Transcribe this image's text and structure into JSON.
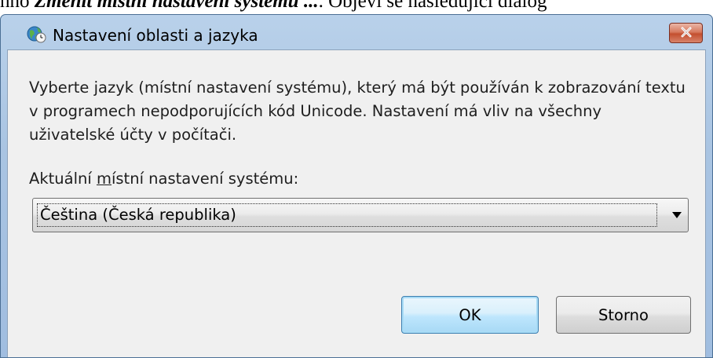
{
  "document": {
    "prefix": "hno ",
    "emphasis": "Změnit místní nastavení systému ...",
    "suffix": ". Objeví se následující dialog"
  },
  "window": {
    "title": "Nastavení oblasti a jazyka",
    "icon": "globe-clock-icon",
    "close_icon": "close-icon",
    "accent_colors": {
      "close": "#c34f2f",
      "frame": "#a9c4e2",
      "client": "#f0f0f0"
    }
  },
  "content": {
    "description": "Vyberte jazyk (místní nastavení systému), který má být používán k zobrazování textu v programech nepodporujících kód Unicode. Nastavení má vliv na všechny uživatelské účty v počítači.",
    "combo_label_pre": "Aktuální ",
    "combo_label_accel": "m",
    "combo_label_post": "ístní nastavení systému:",
    "combo_value": "Čeština (Česká republika)"
  },
  "buttons": {
    "ok": "OK",
    "cancel": "Storno"
  }
}
